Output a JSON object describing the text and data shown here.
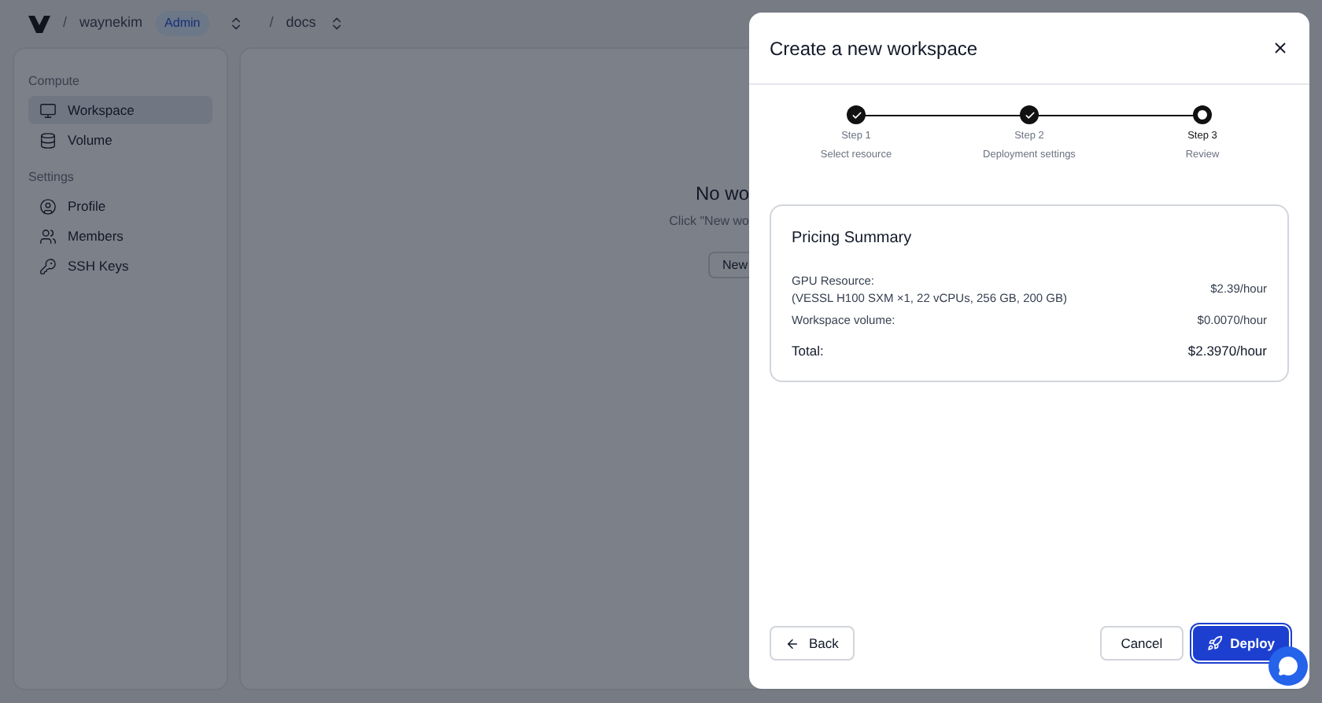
{
  "breadcrumb": {
    "separator_1": "/",
    "user": "waynekim",
    "role": "Admin",
    "separator_2": "/",
    "project": "docs"
  },
  "sidebar": {
    "sections": [
      {
        "title": "Compute",
        "items": [
          {
            "label": "Workspace",
            "selected": true
          },
          {
            "label": "Volume",
            "selected": false
          }
        ]
      },
      {
        "title": "Settings",
        "items": [
          {
            "label": "Profile",
            "selected": false
          },
          {
            "label": "Members",
            "selected": false
          },
          {
            "label": "SSH Keys",
            "selected": false
          }
        ]
      }
    ]
  },
  "empty_state": {
    "title": "No wo",
    "hint": "Click \"New wo",
    "button": "New"
  },
  "modal": {
    "title": "Create a new workspace",
    "steps": [
      {
        "label": "Step 1",
        "caption": "Select resource",
        "kind": "done"
      },
      {
        "label": "Step 2",
        "caption": "Deployment settings",
        "kind": "done"
      },
      {
        "label": "Step 3",
        "caption": "Review",
        "kind": "current"
      }
    ],
    "summary": {
      "title": "Pricing Summary",
      "rows": [
        {
          "label": "GPU Resource:",
          "detail": "(VESSL H100 SXM ×1, 22 vCPUs, 256 GB, 200 GB)",
          "value": "$2.39/hour",
          "kind": "item"
        },
        {
          "label": "Workspace volume:",
          "value": "$0.0070/hour",
          "kind": "item"
        },
        {
          "label": "Total:",
          "value": "$2.3970/hour",
          "kind": "total"
        }
      ]
    },
    "back": "Back",
    "cancel": "Cancel",
    "deploy": "Deploy"
  }
}
